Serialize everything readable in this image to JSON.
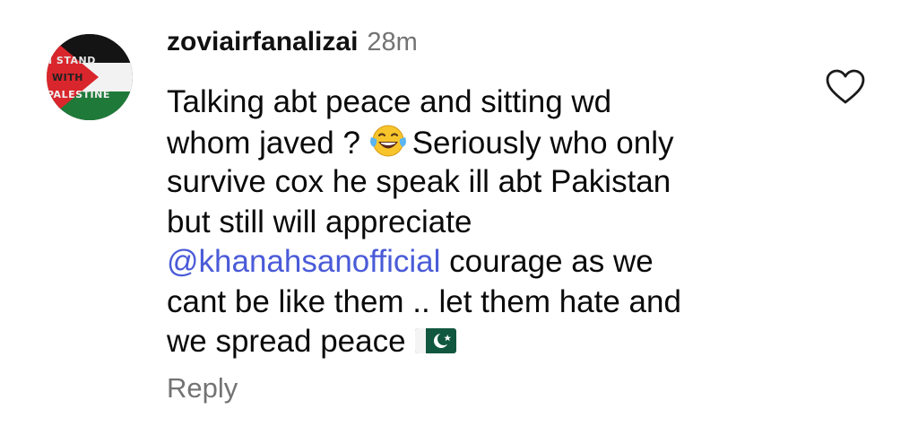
{
  "comment": {
    "username": "zoviairfanalizai",
    "timestamp": "28m",
    "lines": [
      {
        "text": "Talking abt peace and sitting wd"
      },
      {
        "before": "whom javed ?",
        "emoji": "face-with-tears-of-joy",
        "after": "Seriously who only"
      },
      {
        "text": "survive cox he speak ill abt Pakistan"
      },
      {
        "text": "but still will appreciate"
      },
      {
        "mention": "@khanahsanofficial",
        "after": " courage as we"
      },
      {
        "text": "cant be like them .. let them hate and"
      },
      {
        "before": "we spread peace",
        "flag": "pakistan-flag"
      }
    ],
    "reply_label": "Reply",
    "like_icon": "heart-outline-icon"
  },
  "avatar": {
    "line1": "I STAND",
    "line2": "WITH",
    "line3": "PALESTINE",
    "flag_colors": {
      "black": "#141414",
      "white": "#f2f2f2",
      "green": "#1f7a3a",
      "red": "#d9262c"
    }
  },
  "colors": {
    "mention": "#4a5bd8",
    "secondary_text": "#737373"
  }
}
